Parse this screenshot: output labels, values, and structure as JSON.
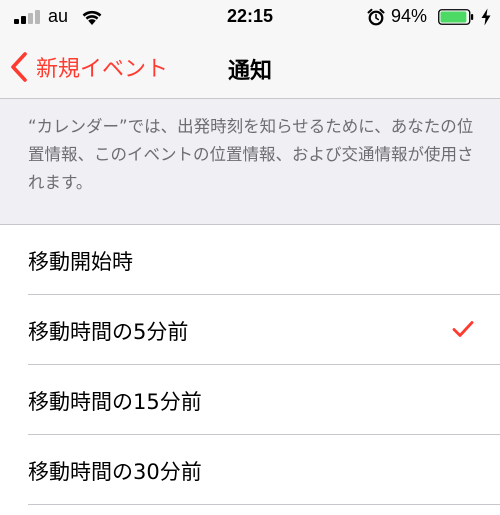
{
  "status_bar": {
    "carrier": "au",
    "time": "22:15",
    "battery_percent": "94%",
    "battery_level": 0.94,
    "signal_bars_active": 2,
    "signal_bars_total": 4,
    "battery_color": "#4cd964"
  },
  "nav": {
    "back_label": "新規イベント",
    "title": "通知",
    "accent_color": "#ff3b30"
  },
  "info": {
    "text": "“カレンダー”では、出発時刻を知らせるために、あなたの位置情報、このイベントの位置情報、および交通情報が使用されます。"
  },
  "options": [
    {
      "label": "移動開始時",
      "selected": false
    },
    {
      "label": "移動時間の5分前",
      "selected": true
    },
    {
      "label": "移動時間の15分前",
      "selected": false
    },
    {
      "label": "移動時間の30分前",
      "selected": false
    }
  ]
}
